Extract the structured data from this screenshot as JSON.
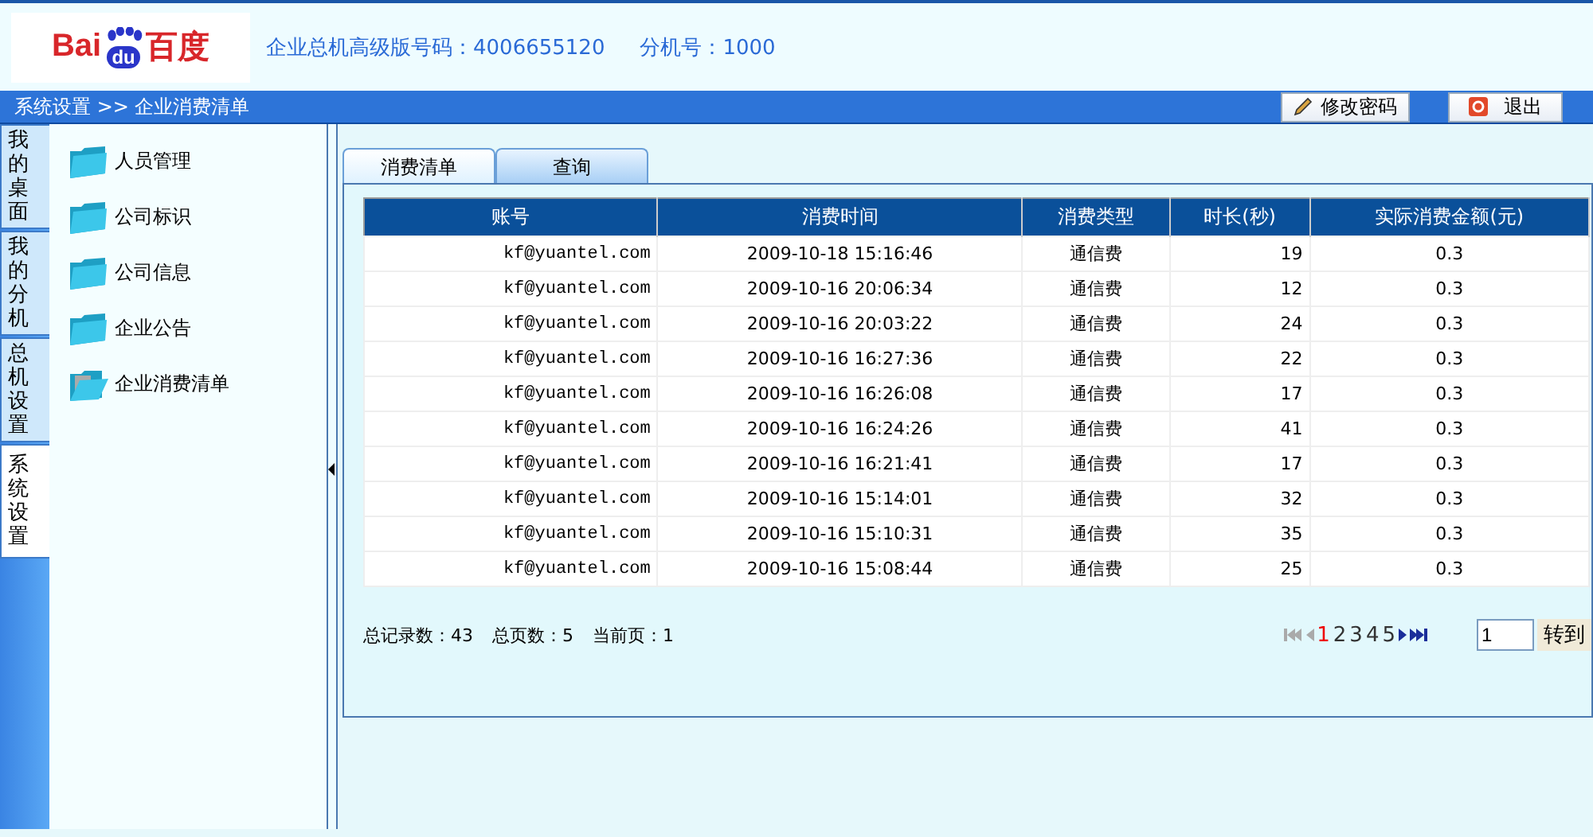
{
  "header": {
    "logo": {
      "left": "Bai",
      "paw": "du",
      "right": "百度"
    },
    "info": [
      {
        "label": "企业总机高级版号码：",
        "value": "4006655120"
      },
      {
        "label": "分机号：",
        "value": "1000"
      }
    ]
  },
  "breadcrumb": {
    "path": [
      "系统设置",
      "企业消费清单"
    ],
    "separator": ">>"
  },
  "top_buttons": [
    {
      "label": "修改密码",
      "kind": "edit"
    },
    {
      "label": "退出",
      "kind": "exit"
    }
  ],
  "side_tabs": [
    {
      "label": "我的桌面",
      "selected": false
    },
    {
      "label": "我的分机",
      "selected": false
    },
    {
      "label": "总机设置",
      "selected": false
    },
    {
      "label": "系统设置",
      "selected": true
    }
  ],
  "tree": [
    {
      "label": "人员管理",
      "open": false
    },
    {
      "label": "公司标识",
      "open": false
    },
    {
      "label": "公司信息",
      "open": false
    },
    {
      "label": "企业公告",
      "open": false
    },
    {
      "label": "企业消费清单",
      "open": true
    }
  ],
  "tabs": [
    {
      "label": "消费清单",
      "selected": true
    },
    {
      "label": "查询",
      "selected": false
    }
  ],
  "table": {
    "columns": [
      "账号",
      "消费时间",
      "消费类型",
      "时长(秒)",
      "实际消费金额(元)"
    ],
    "rows": [
      [
        "kf@yuantel.com",
        "2009-10-18 15:16:46",
        "通信费",
        "19",
        "0.3"
      ],
      [
        "kf@yuantel.com",
        "2009-10-16 20:06:34",
        "通信费",
        "12",
        "0.3"
      ],
      [
        "kf@yuantel.com",
        "2009-10-16 20:03:22",
        "通信费",
        "24",
        "0.3"
      ],
      [
        "kf@yuantel.com",
        "2009-10-16 16:27:36",
        "通信费",
        "22",
        "0.3"
      ],
      [
        "kf@yuantel.com",
        "2009-10-16 16:26:08",
        "通信费",
        "17",
        "0.3"
      ],
      [
        "kf@yuantel.com",
        "2009-10-16 16:24:26",
        "通信费",
        "41",
        "0.3"
      ],
      [
        "kf@yuantel.com",
        "2009-10-16 16:21:41",
        "通信费",
        "17",
        "0.3"
      ],
      [
        "kf@yuantel.com",
        "2009-10-16 15:14:01",
        "通信费",
        "32",
        "0.3"
      ],
      [
        "kf@yuantel.com",
        "2009-10-16 15:10:31",
        "通信费",
        "35",
        "0.3"
      ],
      [
        "kf@yuantel.com",
        "2009-10-16 15:08:44",
        "通信费",
        "25",
        "0.3"
      ]
    ]
  },
  "pager": {
    "summary": [
      {
        "label": "总记录数：",
        "value": "43"
      },
      {
        "label": "总页数：",
        "value": "5"
      },
      {
        "label": "当前页：",
        "value": "1"
      }
    ],
    "pages": [
      {
        "label": "1",
        "selected": true
      },
      {
        "label": "2",
        "selected": false
      },
      {
        "label": "3",
        "selected": false
      },
      {
        "label": "4",
        "selected": false
      },
      {
        "label": "5",
        "selected": false
      }
    ],
    "page_input": "1",
    "go_button": "转到"
  }
}
